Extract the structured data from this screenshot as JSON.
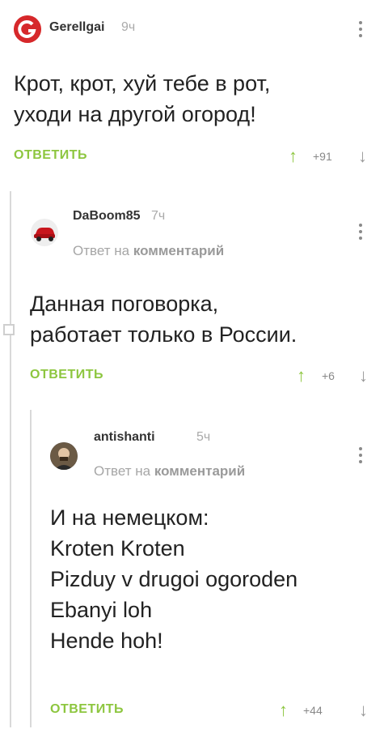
{
  "comments": [
    {
      "author": "Gerellgai",
      "time": "9ч",
      "reply_to": null,
      "lines": [
        "Крот, крот, хуй тебе в рот,",
        "уходи на другой огород!"
      ],
      "reply_label": "ОТВЕТИТЬ",
      "score": "+91"
    },
    {
      "author": "DaBoom85",
      "time": "7ч",
      "reply_to": {
        "prefix": "Ответ на",
        "target": "комментарий"
      },
      "lines": [
        "Данная поговорка,",
        "работает только в России."
      ],
      "reply_label": "ОТВЕТИТЬ",
      "score": "+6"
    },
    {
      "author": "antishanti",
      "time": "5ч",
      "reply_to": {
        "prefix": "Ответ на",
        "target": "комментарий"
      },
      "lines": [
        "И на немецком:",
        "Kroten Kroten",
        "Pizduy v drugoi ogoroden",
        "Ebanyi loh",
        "Hende hoh!"
      ],
      "reply_label": "ОТВЕТИТЬ",
      "score": "+44"
    }
  ],
  "icons": {
    "upvote": "arrow-up-icon",
    "downvote": "arrow-down-icon",
    "more": "more-vertical-icon"
  },
  "colors": {
    "accent_green": "#8dc63f",
    "avatar_red": "#d6282b"
  }
}
